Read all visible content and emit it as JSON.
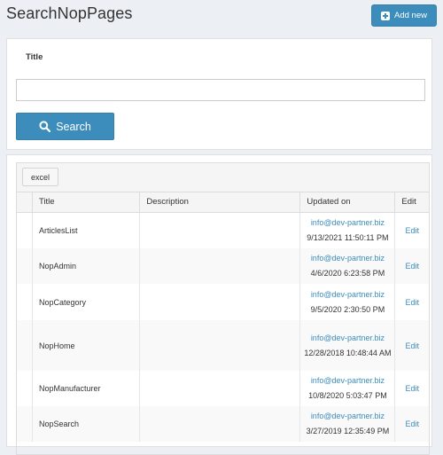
{
  "header": {
    "title": "SearchNopPages",
    "add_new_label": "Add new"
  },
  "search": {
    "title_label": "Title",
    "title_value": "",
    "search_button_label": "Search"
  },
  "grid": {
    "toolbar": {
      "excel_label": "excel"
    },
    "columns": [
      "Title",
      "Description",
      "Updated on",
      "Edit"
    ],
    "rows": [
      {
        "title": "ArticlesList",
        "description": "",
        "updated_by": "info@dev-partner.biz",
        "updated_on": "9/13/2021 11:50:11 PM",
        "edit": "Edit"
      },
      {
        "title": "NopAdmin",
        "description": "",
        "updated_by": "info@dev-partner.biz",
        "updated_on": "4/6/2020 6:23:58 PM",
        "edit": "Edit"
      },
      {
        "title": "NopCategory",
        "description": "",
        "updated_by": "info@dev-partner.biz",
        "updated_on": "9/5/2020 2:30:50 PM",
        "edit": "Edit"
      },
      {
        "title": "NopHome",
        "description": "",
        "updated_by": "info@dev-partner.biz",
        "updated_on": "12/28/2018 10:48:44 AM",
        "edit": "Edit"
      },
      {
        "title": "NopManufacturer",
        "description": "",
        "updated_by": "info@dev-partner.biz",
        "updated_on": "10/8/2020 5:03:47 PM",
        "edit": "Edit"
      },
      {
        "title": "NopSearch",
        "description": "",
        "updated_by": "info@dev-partner.biz",
        "updated_on": "3/27/2019 12:35:49 PM",
        "edit": "Edit"
      }
    ]
  },
  "colors": {
    "primary": "#3c8dbc",
    "background": "#ecf0f5"
  }
}
